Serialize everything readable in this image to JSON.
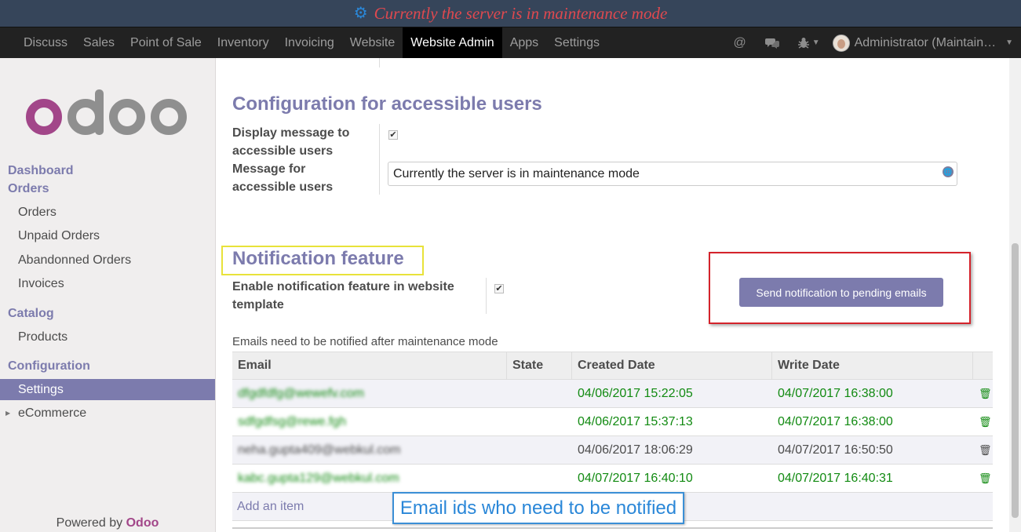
{
  "banner": {
    "text": "Currently the server is in maintenance mode",
    "icon": "gears-icon"
  },
  "navbar": {
    "menu": [
      "Discuss",
      "Sales",
      "Point of Sale",
      "Inventory",
      "Invoicing",
      "Website",
      "Website Admin",
      "Apps",
      "Settings"
    ],
    "active": "Website Admin",
    "user": "Administrator (Maintain…"
  },
  "sidebar": {
    "sections": [
      {
        "title": "Dashboard"
      },
      {
        "title": "Orders",
        "items": [
          "Orders",
          "Unpaid Orders",
          "Abandonned Orders",
          "Invoices"
        ]
      },
      {
        "title": "Catalog",
        "items": [
          "Products"
        ]
      },
      {
        "title": "Configuration",
        "items": [
          "Settings",
          "eCommerce"
        ]
      }
    ],
    "active_item": "Settings",
    "powered_prefix": "Powered by",
    "powered_brand": "Odoo"
  },
  "config": {
    "title": "Configuration for accessible users",
    "display_label_1": "Display message to",
    "display_label_2": "accessible users",
    "display_checked": true,
    "message_label_1": "Message for",
    "message_label_2": "accessible users",
    "message_value": "Currently the server is in maintenance mode"
  },
  "notification": {
    "title": "Notification feature",
    "enable_label_1": "Enable notification feature in website",
    "enable_label_2": "template",
    "enable_checked": true,
    "send_button": "Send notification to pending emails",
    "caption": "Emails need to be notified after maintenance mode"
  },
  "table": {
    "columns": [
      "Email",
      "State",
      "Created Date",
      "Write Date"
    ],
    "rows": [
      {
        "email": "dfgdfdfg@wewefv.com",
        "state": "",
        "created": "04/06/2017 15:22:05",
        "write": "04/07/2017 16:38:00",
        "status": "green"
      },
      {
        "email": "sdfgdfsg@rewe.fgh",
        "state": "",
        "created": "04/06/2017 15:37:13",
        "write": "04/07/2017 16:38:00",
        "status": "green"
      },
      {
        "email": "neha.gupta409@webkul.com",
        "state": "",
        "created": "04/06/2017 18:06:29",
        "write": "04/07/2017 16:50:50",
        "status": "dark"
      },
      {
        "email": "kabc.gupta129@webkul.com",
        "state": "",
        "created": "04/07/2017 16:40:10",
        "write": "04/07/2017 16:40:31",
        "status": "green"
      }
    ],
    "add_item": "Add an item"
  },
  "annotation": {
    "text": "Email ids who need to be notified"
  },
  "colors": {
    "accent": "#7c7bad",
    "brand": "#a24689",
    "green": "#118a11",
    "banner_bg": "#36455a",
    "banner_text": "#e0494f"
  }
}
